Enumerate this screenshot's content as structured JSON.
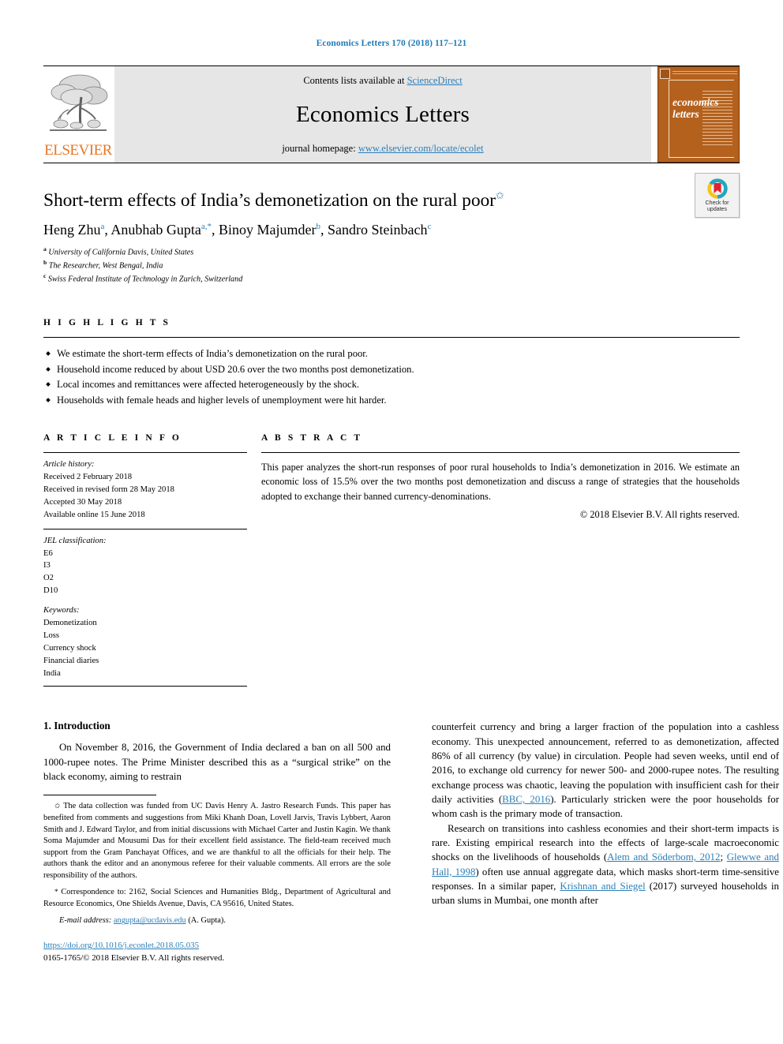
{
  "running_head": "Economics Letters 170 (2018) 117–121",
  "banner": {
    "publisher_wordmark": "ELSEVIER",
    "contents_prefix": "Contents lists available at ",
    "contents_link": "ScienceDirect",
    "journal_title": "Economics Letters",
    "homepage_prefix": "journal homepage: ",
    "homepage_link": "www.elsevier.com/locate/ecolet",
    "cover_title_line1": "economics",
    "cover_title_line2": "letters"
  },
  "article": {
    "title": "Short-term effects of India’s demonetization on the rural poor",
    "title_footnote_mark": "✩",
    "authors": [
      {
        "name": "Heng Zhu",
        "marks": "a"
      },
      {
        "name": "Anubhab Gupta",
        "marks": "a,*"
      },
      {
        "name": "Binoy Majumder",
        "marks": "b"
      },
      {
        "name": "Sandro Steinbach",
        "marks": "c"
      }
    ],
    "affiliations": [
      {
        "mark": "a",
        "text": "University of California Davis, United States"
      },
      {
        "mark": "b",
        "text": "The Researcher, West Bengal, India"
      },
      {
        "mark": "c",
        "text": "Swiss Federal Institute of Technology in Zurich, Switzerland"
      }
    ],
    "crossmark_label_line1": "Check for",
    "crossmark_label_line2": "updates"
  },
  "highlights": {
    "heading": "H I G H L I G H T S",
    "items": [
      "We estimate the short-term effects of India’s demonetization on the rural poor.",
      "Household income reduced by about USD 20.6 over the two months post demonetization.",
      "Local incomes and remittances were affected heterogeneously by the shock.",
      "Households with female heads and higher levels of unemployment were hit harder."
    ]
  },
  "article_info": {
    "heading": "A R T I C L E    I N F O",
    "history_heading": "Article history:",
    "history": [
      "Received 2 February 2018",
      "Received in revised form 28 May 2018",
      "Accepted 30 May 2018",
      "Available online 15 June 2018"
    ],
    "jel_heading": "JEL classification:",
    "jel_codes": [
      "E6",
      "I3",
      "O2",
      "D10"
    ],
    "keywords_heading": "Keywords:",
    "keywords": [
      "Demonetization",
      "Loss",
      "Currency shock",
      "Financial diaries",
      "India"
    ]
  },
  "abstract": {
    "heading": "A B S T R A C T",
    "text": "This paper analyzes the short-run responses of poor rural households to India’s demonetization in 2016. We estimate an economic loss of 15.5% over the two months post demonetization and discuss a range of strategies that the households adopted to exchange their banned currency-denominations.",
    "copyright": "© 2018 Elsevier B.V. All rights reserved."
  },
  "body": {
    "section_number_title": "1. Introduction",
    "left_paragraph_1": "On November 8, 2016, the Government of India declared a ban on all 500 and 1000-rupee notes. The Prime Minister described this as a “surgical strike” on the black economy, aiming to restrain",
    "right_paragraph_1_part1": "counterfeit currency and bring a larger fraction of the population into a cashless economy. This unexpected announcement, referred to as demonetization, affected 86% of all currency (by value) in circulation. People had seven weeks, until end of 2016, to exchange old currency for newer 500- and 2000-rupee notes. The resulting exchange process was chaotic, leaving the population with insufficient cash for their daily activities (",
    "right_paragraph_1_cite": "BBC, 2016",
    "right_paragraph_1_part2": "). Particularly stricken were the poor households for whom cash is the primary mode of transaction.",
    "right_paragraph_2_part1": "Research on transitions into cashless economies and their short-term impacts is rare. Existing empirical research into the effects of large-scale macroeconomic shocks on the livelihoods of households (",
    "right_paragraph_2_cite1": "Alem and Söderbom, 2012",
    "right_paragraph_2_sep": "; ",
    "right_paragraph_2_cite2": "Glewwe and Hall, 1998",
    "right_paragraph_2_part2": ") often use annual aggregate data, which masks short-term time-sensitive responses. In a similar paper, ",
    "right_paragraph_2_cite3": "Krishnan and Siegel",
    "right_paragraph_2_part3": " (2017) surveyed households in urban slums in Mumbai, one month after"
  },
  "footnotes": {
    "star_mark": "✩",
    "star_text": "The data collection was funded from UC Davis Henry A. Jastro Research Funds. This paper has benefited from comments and suggestions from Miki Khanh Doan, Lovell Jarvis, Travis Lybbert, Aaron Smith and J. Edward Taylor, and from initial discussions with Michael Carter and Justin Kagin. We thank Soma Majumder and Mousumi Das for their excellent field assistance. The field-team received much support from the Gram Panchayat Offices, and we are thankful to all the officials for their help. The authors thank the editor and an anonymous referee for their valuable comments. All errors are the sole responsibility of the authors.",
    "corr_mark": "*",
    "corr_text": "Correspondence to: 2162, Social Sciences and Humanities Bldg., Department of Agricultural and Resource Economics, One Shields Avenue, Davis, CA 95616, United States.",
    "email_label": "E-mail address:",
    "email_link": "angupta@ucdavis.edu",
    "email_suffix": "(A. Gupta).",
    "doi": "https://doi.org/10.1016/j.econlet.2018.05.035",
    "issn_line": "0165-1765/© 2018 Elsevier B.V. All rights reserved."
  },
  "colors": {
    "link_blue": "#2c7fb8",
    "elsevier_orange": "#E87722",
    "cover_brown": "#b4611e",
    "banner_gray": "#e6e6e6"
  }
}
